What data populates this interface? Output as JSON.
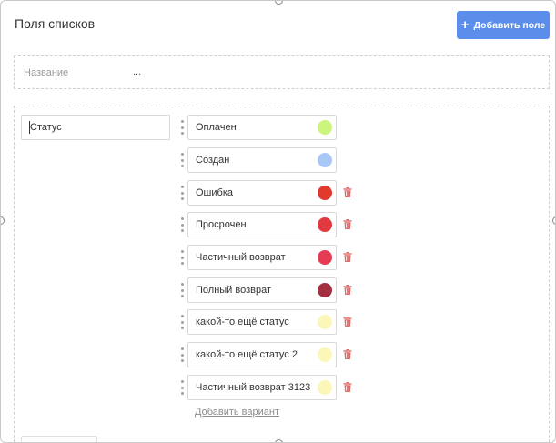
{
  "header": {
    "title": "Поля списков",
    "add_button_label": "Добавить поле",
    "add_button_color": "#5b8dea"
  },
  "name_row": {
    "label": "Название",
    "value": "..."
  },
  "list_field": {
    "name_value": "Статус",
    "options": [
      {
        "label": "Оплачен",
        "color": "#ccf57e",
        "deletable": false
      },
      {
        "label": "Создан",
        "color": "#a8c8f8",
        "deletable": false
      },
      {
        "label": "Ошибка",
        "color": "#e03a2e",
        "deletable": true
      },
      {
        "label": "Просрочен",
        "color": "#e2383f",
        "deletable": true
      },
      {
        "label": "Частичный возврат",
        "color": "#e63b54",
        "deletable": true
      },
      {
        "label": "Полный возврат",
        "color": "#a23040",
        "deletable": true
      },
      {
        "label": "какой-то ещё статус",
        "color": "#fbf7b8",
        "deletable": true
      },
      {
        "label": "какой-то ещё статус 2",
        "color": "#fbf7b8",
        "deletable": true
      },
      {
        "label": "Частичный возврат 3123",
        "color": "#fbf7b8",
        "deletable": true
      }
    ],
    "add_variant_label": "Добавить вариант"
  },
  "icons": {
    "add": "plus-icon",
    "drag": "drag-handle-icon",
    "delete": "trash-icon",
    "delete_color": "#e06a6a"
  }
}
